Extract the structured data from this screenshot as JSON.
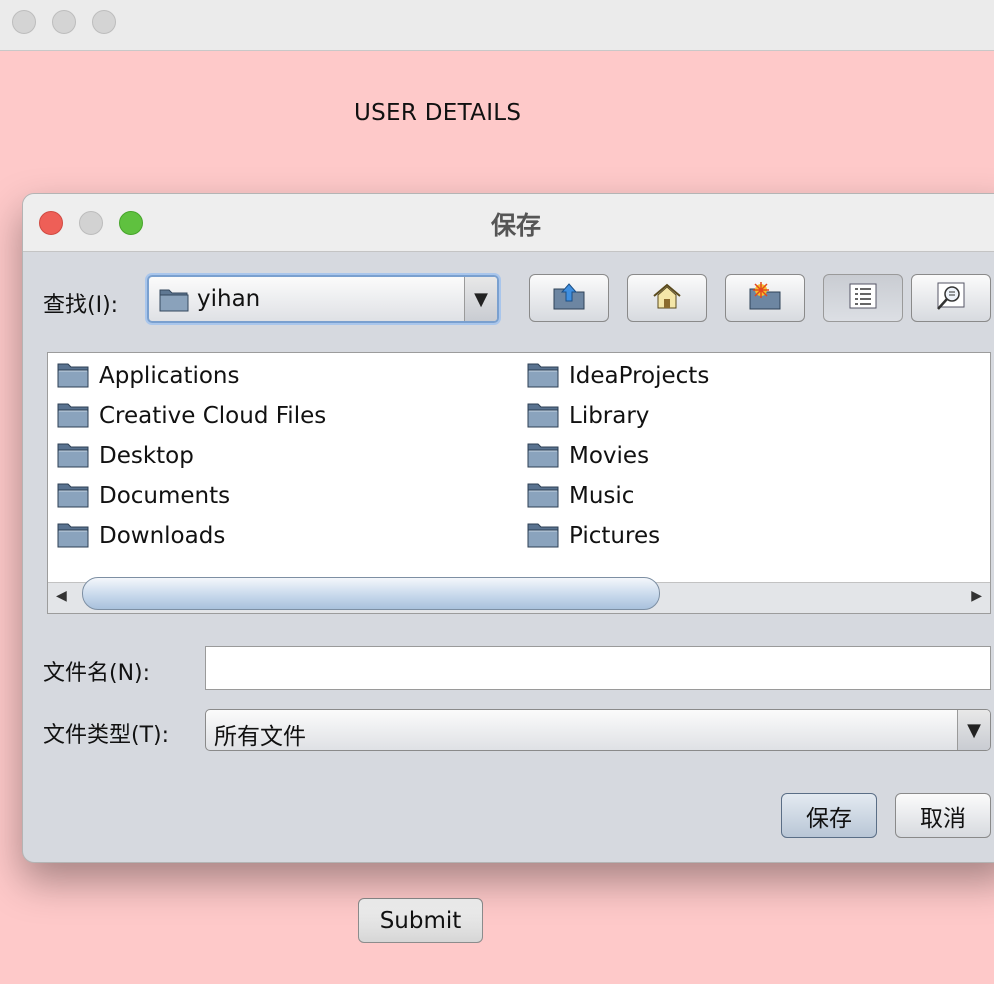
{
  "main_window": {
    "title": "USER DETAILS",
    "submit_label": "Submit"
  },
  "dialog": {
    "title": "保存",
    "look_in_label": "查找(I):",
    "look_in_value": "yihan",
    "toolbar": {
      "up_icon": "up-one-level-icon",
      "home_icon": "home-icon",
      "new_folder_icon": "new-folder-icon",
      "list_view_icon": "list-view-icon",
      "details_view_icon": "details-view-icon"
    },
    "files_left": [
      "Applications",
      "Creative Cloud Files",
      "Desktop",
      "Documents",
      "Downloads"
    ],
    "files_right": [
      "IdeaProjects",
      "Library",
      "Movies",
      "Music",
      "Pictures"
    ],
    "file_name_label": "文件名(N):",
    "file_name_value": "",
    "file_type_label": "文件类型(T):",
    "file_type_value": "所有文件",
    "save_label": "保存",
    "cancel_label": "取消"
  },
  "colors": {
    "window_background": "#fec9c9",
    "dialog_background": "#d6d9df",
    "close_button": "#ee5f57",
    "zoom_button": "#5fc13f"
  }
}
